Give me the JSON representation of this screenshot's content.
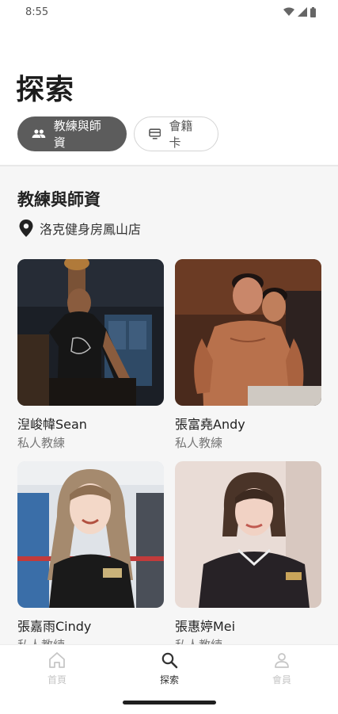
{
  "status": {
    "time": "8:55"
  },
  "header": {
    "title": "探索"
  },
  "chips": [
    {
      "label": "教練與師資",
      "icon": "people-icon",
      "active": true
    },
    {
      "label": "會籍卡",
      "icon": "card-icon",
      "active": false
    }
  ],
  "section": {
    "title": "教練與師資",
    "location": "洛克健身房鳳山店"
  },
  "coaches": [
    {
      "name": "湼峻幃Sean",
      "role": "私人教練"
    },
    {
      "name": "張富堯Andy",
      "role": "私人教練"
    },
    {
      "name": "張嘉雨Cindy",
      "role": "私人教練"
    },
    {
      "name": "張惠婷Mei",
      "role": "私人教練"
    }
  ],
  "nav": [
    {
      "label": "首頁",
      "icon": "home-icon"
    },
    {
      "label": "探索",
      "icon": "search-icon"
    },
    {
      "label": "會員",
      "icon": "person-icon"
    }
  ],
  "colors": {
    "chip_active": "#5c5c5c",
    "nav_active": "#333333",
    "nav_inactive": "#c6c6c6"
  }
}
